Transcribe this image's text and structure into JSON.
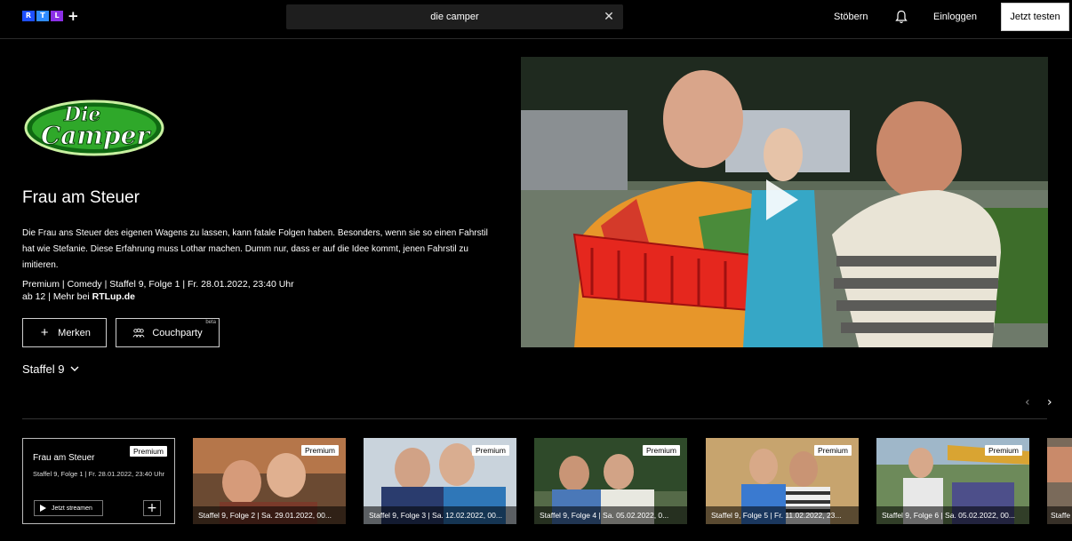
{
  "header": {
    "logo_letters": [
      "R",
      "T",
      "L"
    ],
    "logo_colors": [
      "#1e4fff",
      "#2f8cff",
      "#8b2fe6"
    ],
    "logo_plus": "+",
    "search_value": "die camper",
    "nav_browse": "Stöbern",
    "nav_login": "Einloggen",
    "cta_label": "Jetzt testen"
  },
  "show": {
    "logo_text_line1": "Die",
    "logo_text_line2": "Camper",
    "episode_title": "Frau am Steuer",
    "description": "Die Frau ans Steuer des eigenen Wagens zu lassen, kann fatale Folgen haben. Besonders, wenn sie so einen Fahrstil hat wie Stefanie. Diese Erfahrung muss Lothar machen. Dumm nur, dass er auf die Idee kommt, jenen Fahrstil zu imitieren.",
    "meta_line": "Premium | Comedy | Staffel 9, Folge 1 | Fr. 28.01.2022, 23:40 Uhr",
    "meta_age": "ab 12 | Mehr bei ",
    "meta_link": "RTLup.de",
    "btn_watchlist": "Merken",
    "btn_couchparty": "Couchparty",
    "couchparty_badge": "beta",
    "season_label": "Staffel 9"
  },
  "nav_arrows": {
    "prev": "‹",
    "next": "›"
  },
  "episodes": [
    {
      "title": "Frau am Steuer",
      "subtitle": "Staffel 9, Folge 1 | Fr. 28.01.2022, 23:40 Uhr",
      "badge": "Premium",
      "stream_label": "Jetzt streamen"
    },
    {
      "caption": "Staffel 9, Folge 2 | Sa. 29.01.2022, 00...",
      "badge": "Premium"
    },
    {
      "caption": "Staffel 9, Folge 3 | Sa. 12.02.2022, 00...",
      "badge": "Premium"
    },
    {
      "caption": "Staffel 9, Folge 4 | Sa. 05.02.2022, 0...",
      "badge": "Premium"
    },
    {
      "caption": "Staffel 9, Folge 5 | Fr. 11.02.2022, 23...",
      "badge": "Premium"
    },
    {
      "caption": "Staffel 9, Folge 6 | Sa. 05.02.2022, 00...",
      "badge": "Premium"
    },
    {
      "caption": "Staffe"
    }
  ]
}
